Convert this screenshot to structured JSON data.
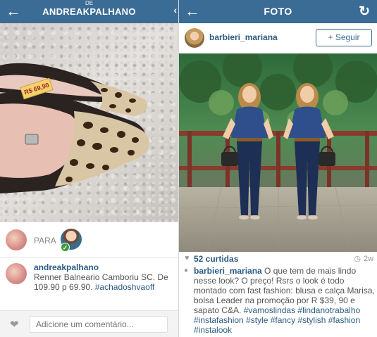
{
  "left": {
    "header": {
      "subtitle": "DE",
      "title": "ANDREAKPALHANO",
      "back_icon": "arrow-left-icon",
      "chevron_icon": "chevron-left-icon"
    },
    "photo": {
      "price_tag": "R$ 69,90",
      "description": "leopard print pointed flats on granite"
    },
    "tagged": {
      "label": "PARA"
    },
    "caption": {
      "username": "andreakpalhano",
      "text": "Renner Balneario Camboriu SC. De 109.90 p 69.90. ",
      "hashtag": "#achadoshvaoff"
    },
    "comment": {
      "placeholder": "Adicione um comentário..."
    }
  },
  "right": {
    "header": {
      "title": "FOTO",
      "back_icon": "arrow-left-icon",
      "refresh_icon": "refresh-icon"
    },
    "profile": {
      "username": "barbieri_mariana",
      "follow_label": "+ Seguir"
    },
    "stats": {
      "likes": "52 curtidas",
      "time": "2w"
    },
    "caption": {
      "username": "barbieri_mariana",
      "text": " O que tem de mais lindo nesse look? O preço! Rsrs o look é todo montado com fast fashion: blusa e calça Marisa,  bolsa Leader na promoção por R $39, 90 e sapato C&A. ",
      "hashtags": "#vamoslindas #lindanotrabalho #instafashion #style #fancy #stylish #fashion #instalook"
    }
  },
  "colors": {
    "header": "#3b6c95",
    "link": "#2c5b84"
  }
}
